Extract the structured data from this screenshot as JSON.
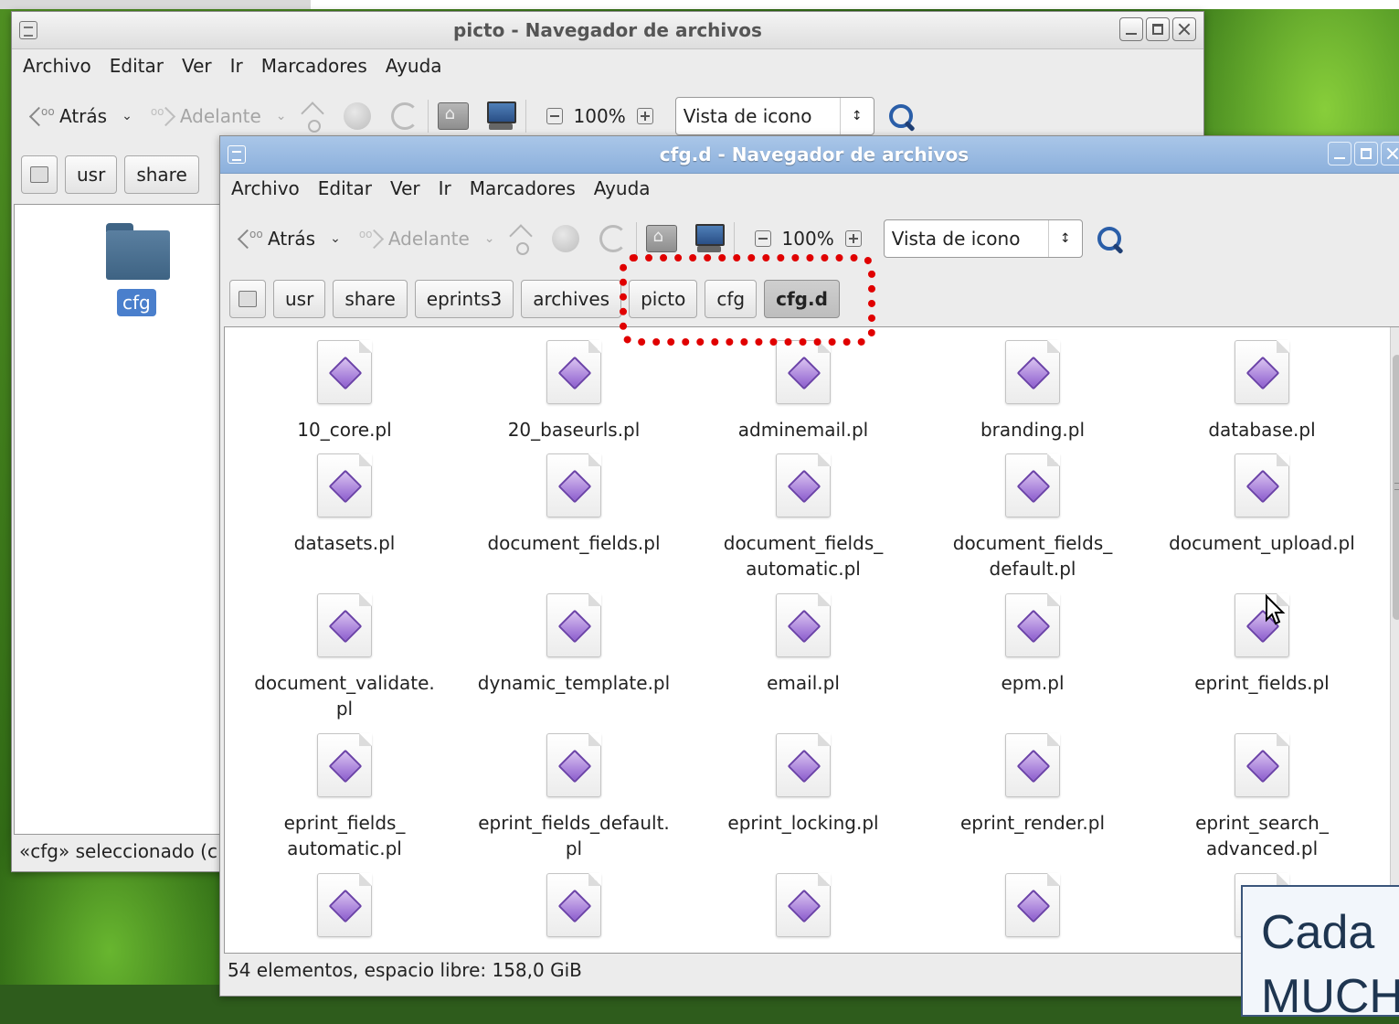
{
  "window1": {
    "title": "picto - Navegador de archivos",
    "menu": [
      "Archivo",
      "Editar",
      "Ver",
      "Ir",
      "Marcadores",
      "Ayuda"
    ],
    "toolbar": {
      "back": "Atrás",
      "forward": "Adelante",
      "zoom": "100%",
      "view": "Vista de icono"
    },
    "path": [
      "usr",
      "share"
    ],
    "folder_label": "cfg",
    "status": "«cfg» seleccionado (c"
  },
  "window2": {
    "title": "cfg.d - Navegador de archivos",
    "menu": [
      "Archivo",
      "Editar",
      "Ver",
      "Ir",
      "Marcadores",
      "Ayuda"
    ],
    "toolbar": {
      "back": "Atrás",
      "forward": "Adelante",
      "zoom": "100%",
      "view": "Vista de icono"
    },
    "path": [
      "usr",
      "share",
      "eprints3",
      "archives",
      "picto",
      "cfg",
      "cfg.d"
    ],
    "files": [
      "10_core.pl",
      "20_baseurls.pl",
      "adminemail.pl",
      "branding.pl",
      "database.pl",
      "datasets.pl",
      "document_fields.pl",
      "document_fields_\nautomatic.pl",
      "document_fields_\ndefault.pl",
      "document_upload.pl",
      "document_validate.\npl",
      "dynamic_template.pl",
      "email.pl",
      "epm.pl",
      "eprint_fields.pl",
      "eprint_fields_\nautomatic.pl",
      "eprint_fields_default.\npl",
      "eprint_locking.pl",
      "eprint_render.pl",
      "eprint_search_\nadvanced.pl",
      "",
      "",
      "",
      "",
      ""
    ],
    "status": "54 elementos, espacio libre: 158,0 GiB"
  },
  "callout": {
    "line1": "Cada",
    "line2": "MUCH"
  },
  "colors": {
    "highlight": "#e00000",
    "title_active": "#8cb0dc",
    "selection": "#4a7fcc"
  }
}
